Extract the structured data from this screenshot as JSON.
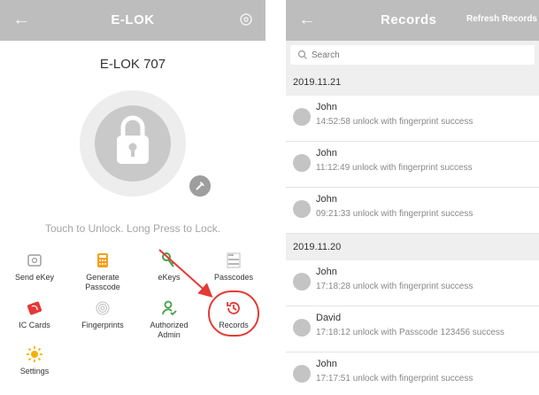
{
  "left_screen": {
    "title": "E-LOK",
    "back_icon": "back-arrow-icon",
    "settings_icon": "gear-icon",
    "lock_name": "E-LOK 707",
    "touch_hint": "Touch to Unlock. Long Press to Lock.",
    "grid": [
      {
        "label": "Send eKey",
        "icon": "send-ekey-icon",
        "color": "#9e9e9e"
      },
      {
        "label": "Generate\nPasscode",
        "icon": "generate-passcode-icon",
        "color": "#f4a020"
      },
      {
        "label": "eKeys",
        "icon": "ekeys-icon",
        "color": "#43a047"
      },
      {
        "label": "Passcodes",
        "icon": "passcodes-icon",
        "color": "#9e9e9e"
      },
      {
        "label": "IC Cards",
        "icon": "ic-card-icon",
        "color": "#e53935"
      },
      {
        "label": "Fingerprints",
        "icon": "fingerprint-icon",
        "color": "#9e9e9e"
      },
      {
        "label": "Authorized\nAdmin",
        "icon": "authorized-admin-icon",
        "color": "#43a047"
      },
      {
        "label": "Records",
        "icon": "records-history-icon",
        "color": "#e53935"
      },
      {
        "label": "Settings",
        "icon": "settings-sun-icon",
        "color": "#f4b000"
      }
    ],
    "annotation_color": "#e53935"
  },
  "right_screen": {
    "title": "Records",
    "refresh_label": "Refresh Records",
    "search_placeholder": "Search",
    "groups": [
      {
        "date": "2019.11.21",
        "records": [
          {
            "name": "John",
            "detail": "14:52:58 unlock with fingerprint success",
            "avatar": "fingerprint"
          },
          {
            "name": "John",
            "detail": "11:12:49 unlock with fingerprint success",
            "avatar": "fingerprint"
          },
          {
            "name": "John",
            "detail": "09:21:33 unlock with fingerprint success",
            "avatar": "fingerprint"
          }
        ]
      },
      {
        "date": "2019.11.20",
        "records": [
          {
            "name": "John",
            "detail": "17:18:28 unlock with fingerprint success",
            "avatar": "fingerprint"
          },
          {
            "name": "David",
            "detail": "17:18:12 unlock with Passcode 123456 success",
            "avatar": "keypad"
          },
          {
            "name": "John",
            "detail": "17:17:51 unlock with fingerprint success",
            "avatar": "fingerprint"
          }
        ]
      }
    ]
  }
}
